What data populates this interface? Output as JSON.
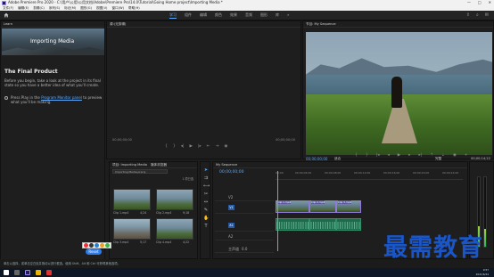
{
  "window": {
    "title": "Adobe Premiere Pro 2020 - C:\\用户\\公用\\公用文档\\Adobe\\Premiere Pro\\14.0\\Tutorial\\Going Home project\\Importing Media *",
    "controls": [
      "—",
      "□",
      "✕"
    ]
  },
  "menu": [
    "文件(F)",
    "编辑(E)",
    "剪辑(C)",
    "序列(S)",
    "标记(M)",
    "图形(G)",
    "视图(V)",
    "窗口(W)",
    "帮助(H)"
  ],
  "workspaces": {
    "tabs": [
      "学习",
      "组件",
      "编辑",
      "颜色",
      "效果",
      "音频",
      "图形",
      "库"
    ],
    "active": "学习",
    "more": "»"
  },
  "learn": {
    "panel_label": "Learn",
    "hero_title": "Importing Media",
    "product_title": "The Final Product",
    "description": "Before you begin, take a look at the project in its final state so you have a better idea of what you'll create.",
    "step_prefix": "Press Play in the",
    "step_link": "Program Monitor panel",
    "step_suffix": "to preview what you'll be making.",
    "all_label": "◂ All",
    "reset_label": "Reset"
  },
  "source": {
    "tab_label": "源:(无剪辑)",
    "timecode_in": "00;00;00;00",
    "timecode_out": "00;00;00;00"
  },
  "program": {
    "tab_label": "节目: My Sequence",
    "timecode": "00;00;00;00",
    "fit_label": "适合",
    "full_label": "完整",
    "duration": "00;00;14;22"
  },
  "project": {
    "tab_label": "项目: Importing Media",
    "tab2_label": "媒体浏览器",
    "search_label": "Importing Media.prproj",
    "count": "1 项已选",
    "clips": [
      {
        "name": "Clip 1.mp4",
        "dur": "4;24"
      },
      {
        "name": "Clip 2.mp4",
        "dur": "9;18"
      },
      {
        "name": "Clip 3.mp4",
        "dur": "5;17"
      },
      {
        "name": "Clip 4.mp4",
        "dur": "4;22"
      }
    ]
  },
  "timeline": {
    "tab_label": "My Sequence",
    "timecode": "00;00;00;00",
    "ruler": [
      "00;00",
      "00;00;04;00",
      "00;00;08;00",
      "00;00;12;00",
      "00;00;16;00",
      "00;00;20;00",
      "00;00;24;00"
    ],
    "tracks": {
      "v": "V1",
      "a": "A1",
      "v2": "V2",
      "a2": "A2",
      "master": "主声道",
      "master_val": "0.0"
    }
  },
  "status": {
    "left": "单击以选择，或单击空白处并拖动以进行框选。使用 Shift、Alt 和 Ctrl 可获得其他选项。"
  },
  "taskbar": {
    "time": "9:57",
    "date": "2021/6/24"
  },
  "watermark": "最需教育",
  "colors": {
    "accent": "#2e7be6",
    "timecode": "#5aa9ff",
    "clip_video": "#8f7bd6",
    "clip_audio": "#1f6a4c"
  }
}
